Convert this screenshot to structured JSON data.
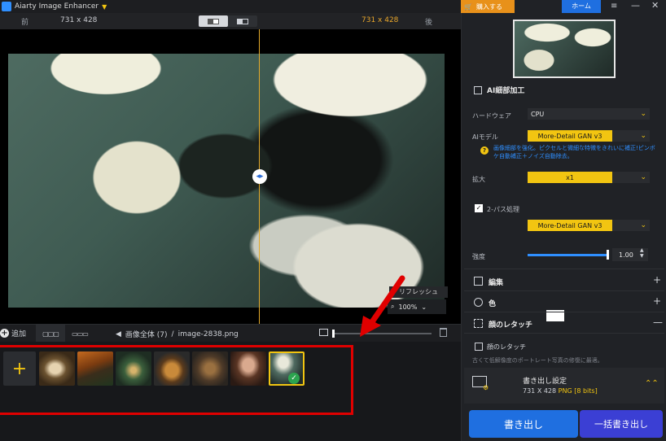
{
  "app": {
    "title": "Aiarty Image Enhancer"
  },
  "compare": {
    "before_label": "前",
    "after_label": "後",
    "left_size": "731 x 428",
    "right_size": "731 x 428"
  },
  "preview": {
    "refresh_label": "リフレッシュ",
    "zoom": "100%"
  },
  "toolbar": {
    "add_label": "追加",
    "breadcrumb_root": "画像全体 (7)",
    "breadcrumb_sep": "/",
    "breadcrumb_file": "image-2838.png"
  },
  "thumbnails": {
    "count": 7,
    "selected_index": 6
  },
  "topbar": {
    "buy_label": "購入する",
    "home_label": "ホーム"
  },
  "ai_section": {
    "title": "AI細部加工",
    "hardware_label": "ハードウェア",
    "hardware_value": "CPU",
    "model_label": "AIモデル",
    "model_value": "More-Detail GAN  v3",
    "model_desc": "画像細部を強化。ピクセルと微細な特徴をきれいに補正!ピンボケ自動補正＋ノイズ自動除去。",
    "scale_label": "拡大",
    "scale_value": "x1",
    "twopass_label": "2-パス処理",
    "twopass_checked": true,
    "twopass_model": "More-Detail GAN  v3",
    "strength_label": "強度",
    "strength_value": "1.00",
    "strength_fraction": 1.0
  },
  "sections": {
    "edit_label": "編集",
    "color_label": "色",
    "face_label": "顔のレタッチ",
    "face_cb_label": "顔のレタッチ",
    "face_desc": "古くて低解像度のポートレート写真の修復に最適。"
  },
  "export": {
    "title": "書き出し設定",
    "size": "731 X 428",
    "format": "PNG",
    "bits": "[8 bits]",
    "export_label": "書き出し",
    "batch_label": "一括書き出し"
  },
  "colors": {
    "accent": "#f2c511",
    "primary": "#1f6fe0",
    "highlight": "#e00000"
  }
}
